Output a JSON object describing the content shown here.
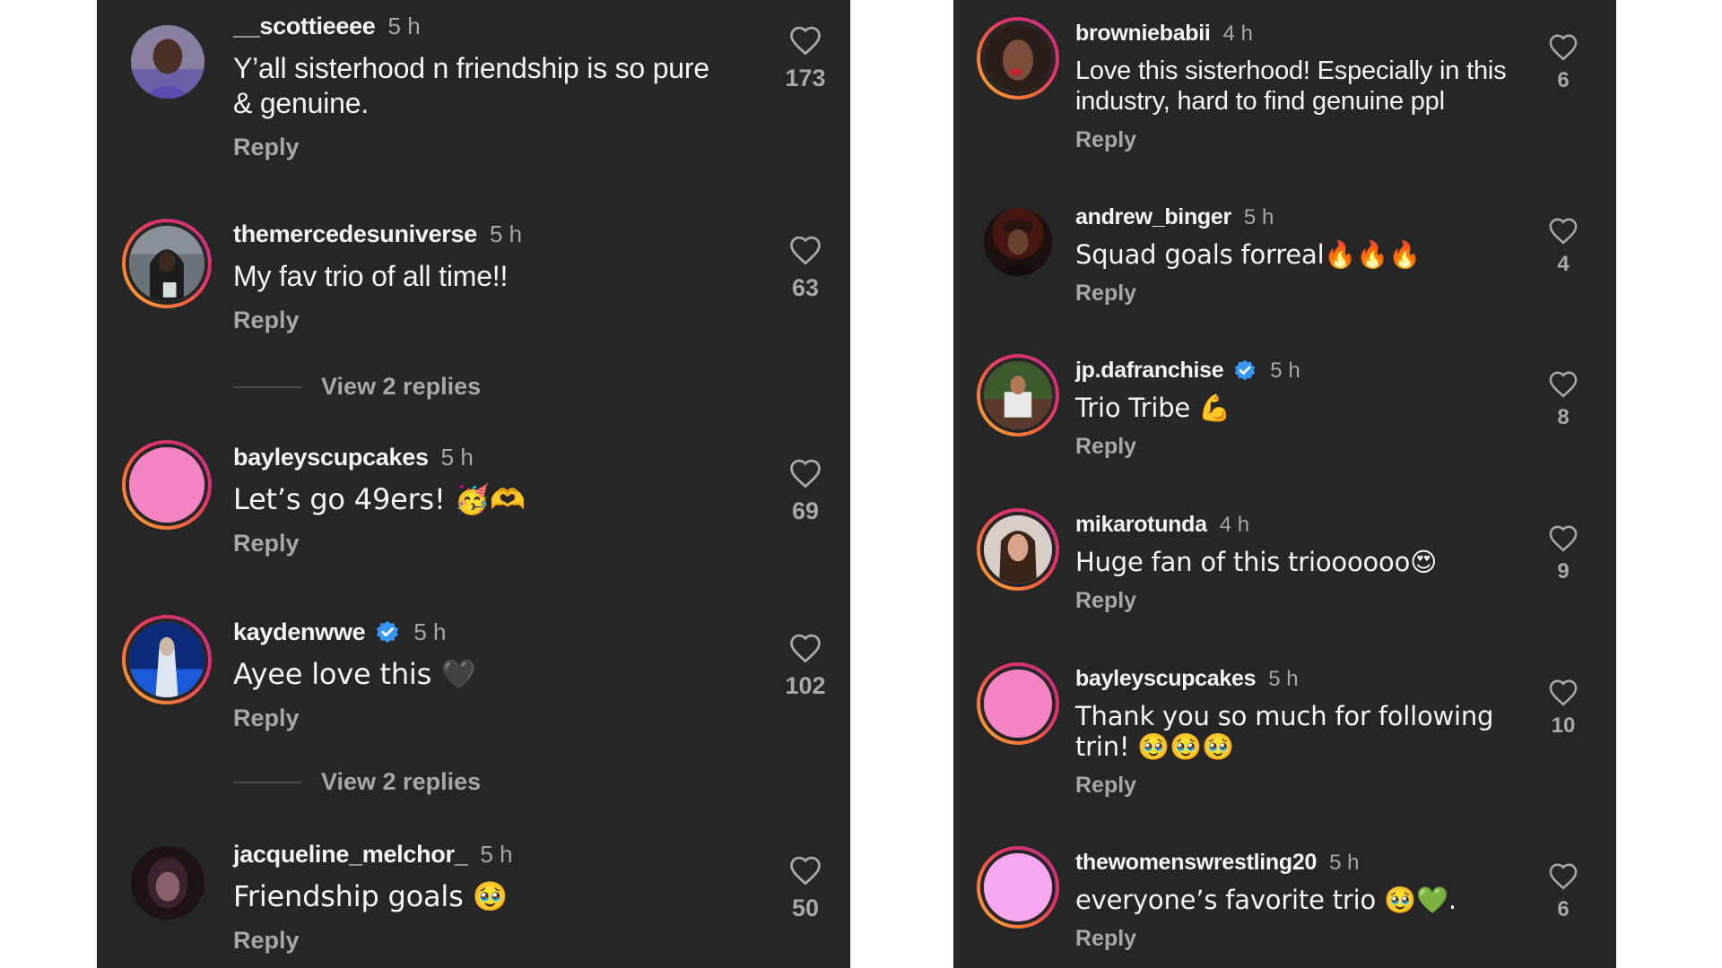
{
  "reply_label": "Reply",
  "view_replies_label": "View 2 replies",
  "colors": {
    "background": "#262626",
    "text": "#f5f5f5",
    "muted": "#a8a8a8",
    "verified": "#3897f0"
  },
  "left_comments": [
    {
      "username": "__scottieeee",
      "time": "5 h",
      "text": "Y’all sisterhood n friendship is so pure & genuine.",
      "likes": "173",
      "verified": false,
      "avatar": "photo-man"
    },
    {
      "username": "themercedesuniverse",
      "time": "5 h",
      "text": "My fav trio of all time!!",
      "likes": "63",
      "verified": false,
      "avatar": "photo-hooded",
      "has_replies": true
    },
    {
      "username": "bayleyscupcakes",
      "time": "5 h",
      "text": "Let’s go 49ers! 🥳🫶",
      "likes": "69",
      "verified": false,
      "avatar": "pink-circle"
    },
    {
      "username": "kaydenwwe",
      "time": "5 h",
      "text": "Ayee love this 🖤",
      "likes": "102",
      "verified": true,
      "avatar": "photo-stage",
      "has_replies": true
    },
    {
      "username": "jacqueline_melchor_",
      "time": "5 h",
      "text": "Friendship goals 🥹",
      "likes": "50",
      "verified": false,
      "avatar": "photo-woman"
    }
  ],
  "right_comments": [
    {
      "username": "browniebabii",
      "time": "4 h",
      "text": "Love this sisterhood! Especially in this industry, hard to find genuine ppl",
      "likes": "6",
      "verified": false,
      "avatar": "photo-woman-red-lips"
    },
    {
      "username": "andrew_binger",
      "time": "5 h",
      "text": "Squad goals forreal🔥🔥🔥",
      "likes": "4",
      "verified": false,
      "avatar": "photo-man-cap"
    },
    {
      "username": "jp.dafranchise",
      "time": "5 h",
      "text": "Trio Tribe 💪",
      "likes": "8",
      "verified": true,
      "avatar": "photo-man-sitting"
    },
    {
      "username": "mikarotunda",
      "time": "4 h",
      "text": "Huge fan of this trioooooo😍",
      "likes": "9",
      "verified": false,
      "avatar": "photo-woman-brunette"
    },
    {
      "username": "bayleyscupcakes",
      "time": "5 h",
      "text": "Thank you so much for following trin! 🥹🥹🥹",
      "likes": "10",
      "verified": false,
      "avatar": "pink-circle"
    },
    {
      "username": "thewomenswrestling20",
      "time": "5 h",
      "text": "everyone’s favorite trio 🥹💚.",
      "likes": "6",
      "verified": false,
      "avatar": "light-pink-circle"
    }
  ]
}
